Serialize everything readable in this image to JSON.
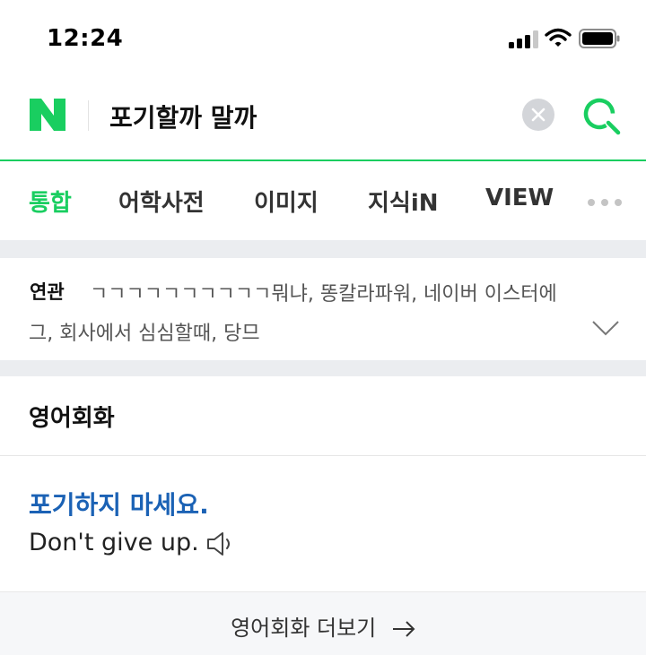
{
  "status_bar": {
    "time": "12:24"
  },
  "search": {
    "query": "포기할까 말까",
    "brand_color": "#19ce60"
  },
  "tabs": [
    {
      "label": "통합",
      "active": true
    },
    {
      "label": "어학사전",
      "active": false
    },
    {
      "label": "이미지",
      "active": false
    },
    {
      "label": "지식iN",
      "active": false
    },
    {
      "label": "VIEW",
      "active": false
    }
  ],
  "related": {
    "label": "연관",
    "line1": "ㄱㄱㄱㄱㄱㄱㄱㄱㄱㄱ뭐냐, 똥칼라파워, 네이버 이스터에",
    "line2": "그, 회사에서 심심할때, 당므"
  },
  "conversation": {
    "title": "영어회화",
    "korean": "포기하지 마세요.",
    "english": "Don't give up.",
    "more_label": "영어회화 더보기",
    "link_color": "#1b62b5"
  },
  "icons": [
    "signal-icon",
    "wifi-icon",
    "battery-icon",
    "naver-logo",
    "clear-icon",
    "search-icon",
    "more-icon",
    "chevron-down-icon",
    "speaker-icon",
    "arrow-right-icon"
  ]
}
